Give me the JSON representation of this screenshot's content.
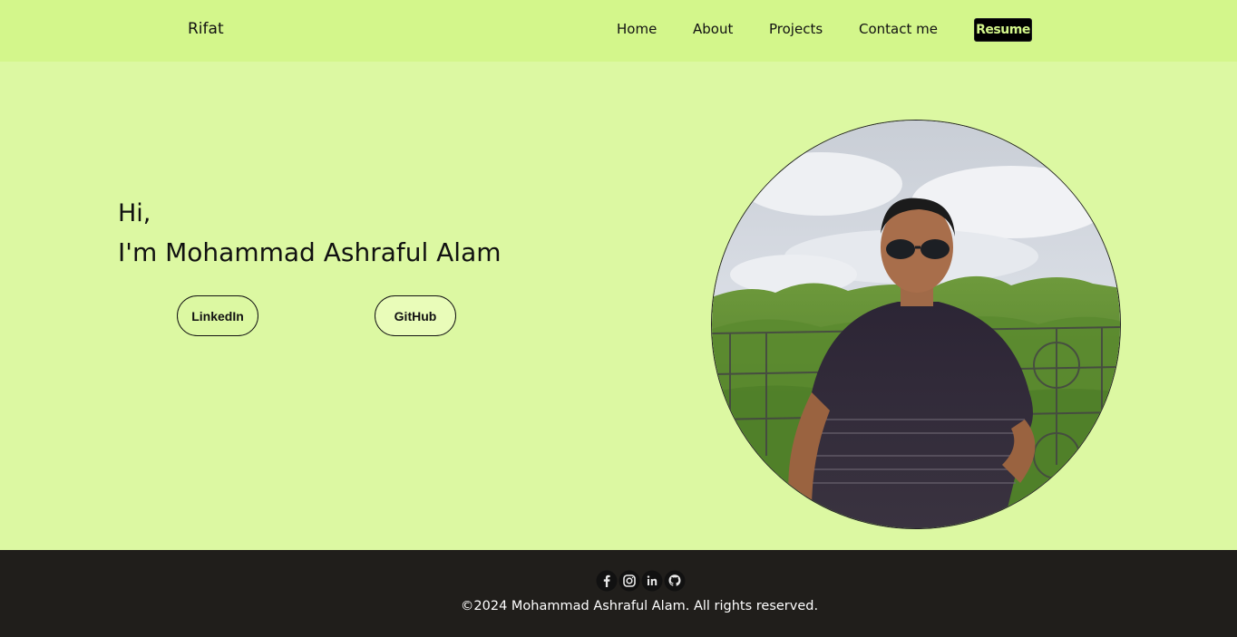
{
  "navbar": {
    "brand": "Rifat",
    "links": [
      "Home",
      "About",
      "Projects",
      "Contact me"
    ],
    "resume_label": "Resume"
  },
  "hero": {
    "greeting": "Hi,",
    "name": "I'm Mohammad Ashraful Alam",
    "buttons": [
      "LinkedIn",
      "GitHub"
    ]
  },
  "footer": {
    "social_icons": [
      "facebook-icon",
      "instagram-icon",
      "linkedin-icon",
      "github-icon"
    ],
    "copyright": "©2024 Mohammad Ashraful Alam. All rights reserved."
  },
  "colors": {
    "navbar_bg": "#d3f68b",
    "page_bg": "#dcf8a2",
    "footer_bg": "#201e1b",
    "resume_bg": "#000000"
  }
}
